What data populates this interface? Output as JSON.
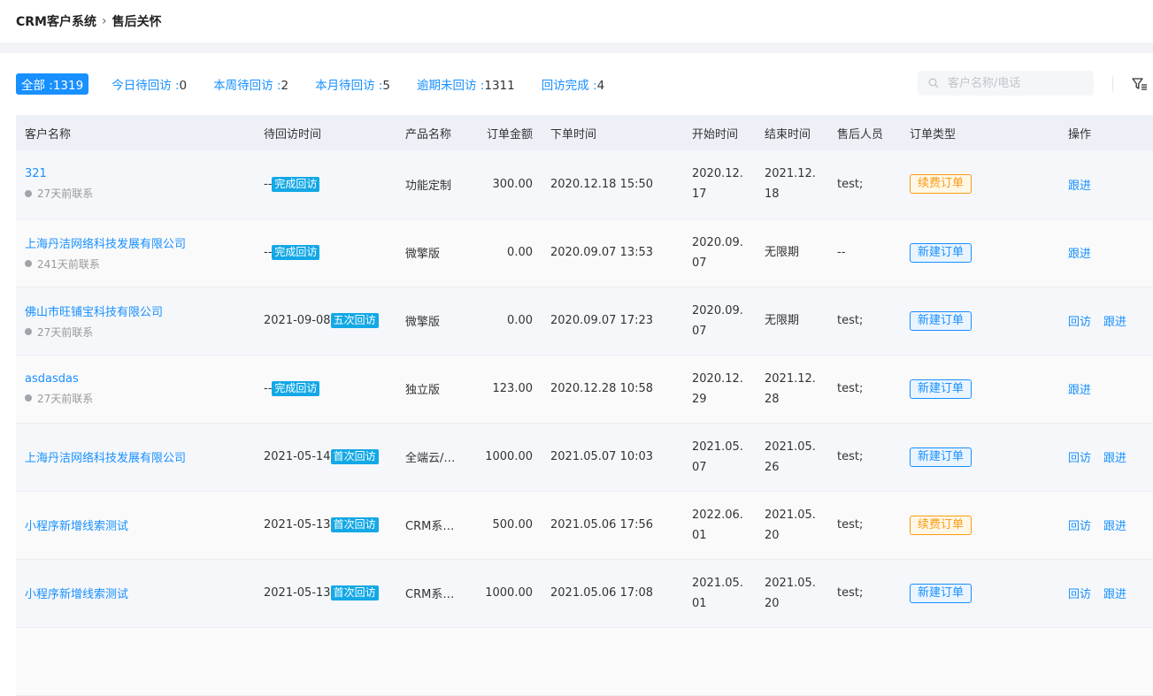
{
  "breadcrumb": {
    "root": "CRM客户系统",
    "separator": "›",
    "current": "售后关怀"
  },
  "filters": [
    {
      "label": "全部 :",
      "count": "1319"
    },
    {
      "label": "今日待回访 :",
      "count": "0"
    },
    {
      "label": "本周待回访 :",
      "count": "2"
    },
    {
      "label": "本月待回访 :",
      "count": "5"
    },
    {
      "label": "逾期未回访 :",
      "count": "1311"
    },
    {
      "label": "回访完成 :",
      "count": "4"
    }
  ],
  "search": {
    "placeholder": "客户名称/电话"
  },
  "table": {
    "headers": [
      "客户名称",
      "待回访时间",
      "产品名称",
      "订单金额",
      "下单时间",
      "开始时间",
      "结束时间",
      "售后人员",
      "订单类型",
      "操作"
    ],
    "rows": [
      {
        "name": "321",
        "sub": "27天前联系",
        "pending_date": "--",
        "pending_tag": "完成回访",
        "product": "功能定制",
        "amount": "300.00",
        "order_time": "2020.12.18 15:50",
        "start": "2020.12.17",
        "end": "2021.12.18",
        "staff": "test;",
        "order_type": "续费订单",
        "type_color": "#fa9b14",
        "action1": "",
        "action2": "跟进"
      },
      {
        "name": "上海丹洁网络科技发展有限公司",
        "sub": "241天前联系",
        "pending_date": "--",
        "pending_tag": "完成回访",
        "product": "微擎版",
        "amount": "0.00",
        "order_time": "2020.09.07 13:53",
        "start": "2020.09.07",
        "end": "无限期",
        "staff": "--",
        "order_type": "新建订单",
        "type_color": "#1890ff",
        "action1": "",
        "action2": "跟进"
      },
      {
        "name": "佛山市旺铺宝科技有限公司",
        "sub": "27天前联系",
        "pending_date": "2021-09-08",
        "pending_tag": "五次回访",
        "product": "微擎版",
        "amount": "0.00",
        "order_time": "2020.09.07 17:23",
        "start": "2020.09.07",
        "end": "无限期",
        "staff": "test;",
        "order_type": "新建订单",
        "type_color": "#1890ff",
        "action1": "回访",
        "action2": "跟进"
      },
      {
        "name": "asdasdas",
        "sub": "27天前联系",
        "pending_date": "--",
        "pending_tag": "完成回访",
        "product": "独立版",
        "amount": "123.00",
        "order_time": "2020.12.28 10:58",
        "start": "2020.12.29",
        "end": "2021.12.28",
        "staff": "test;",
        "order_type": "新建订单",
        "type_color": "#1890ff",
        "action1": "",
        "action2": "跟进"
      },
      {
        "name": "上海丹洁网络科技发展有限公司",
        "sub": "",
        "pending_date": "2021-05-14",
        "pending_tag": "首次回访",
        "product": "全端云/…",
        "amount": "1000.00",
        "order_time": "2021.05.07 10:03",
        "start": "2021.05.07",
        "end": "2021.05.26",
        "staff": "test;",
        "order_type": "新建订单",
        "type_color": "#1890ff",
        "action1": "回访",
        "action2": "跟进"
      },
      {
        "name": "小程序新增线索测试",
        "sub": "",
        "pending_date": "2021-05-13",
        "pending_tag": "首次回访",
        "product": "CRM系…",
        "amount": "500.00",
        "order_time": "2021.05.06 17:56",
        "start": "2022.06.01",
        "end": "2021.05.20",
        "staff": "test;",
        "order_type": "续费订单",
        "type_color": "#fa9b14",
        "action1": "回访",
        "action2": "跟进"
      },
      {
        "name": "小程序新增线索测试",
        "sub": "",
        "pending_date": "2021-05-13",
        "pending_tag": "首次回访",
        "product": "CRM系…",
        "amount": "1000.00",
        "order_time": "2021.05.06 17:08",
        "start": "2021.05.01",
        "end": "2021.05.20",
        "staff": "test;",
        "order_type": "新建订单",
        "type_color": "#1890ff",
        "action1": "回访",
        "action2": "跟进"
      }
    ]
  }
}
